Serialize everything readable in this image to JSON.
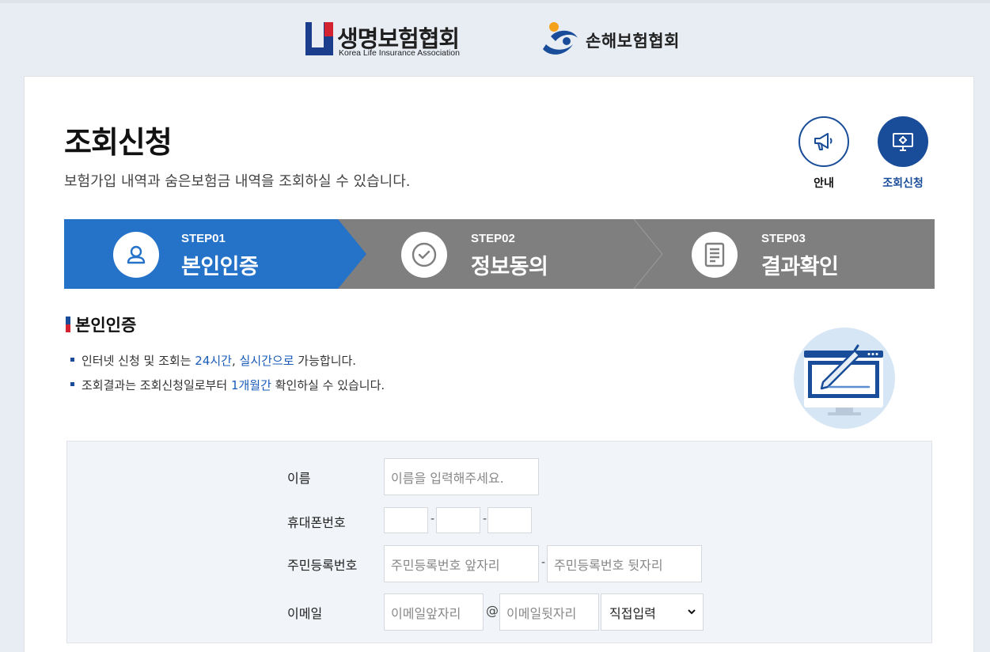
{
  "header": {
    "life_logo_name": "생명보험협회",
    "life_logo_sub": "Korea Life Insurance Association",
    "nonlife_logo_name": "손해보험협회"
  },
  "page": {
    "title": "조회신청",
    "description": "보험가입 내역과 숨은보험금 내역을 조회하실 수 있습니다."
  },
  "quick_links": {
    "guide_label": "안내",
    "inquiry_label": "조회신청"
  },
  "steps": [
    {
      "num": "STEP01",
      "name": "본인인증",
      "active": true
    },
    {
      "num": "STEP02",
      "name": "정보동의",
      "active": false
    },
    {
      "num": "STEP03",
      "name": "결과확인",
      "active": false
    }
  ],
  "colors": {
    "active_step": "#2572c9",
    "inactive_step": "#7f7f7f",
    "brand_blue": "#1a4d99",
    "brand_red": "#d32230"
  },
  "section": {
    "title": "본인인증",
    "note1_pre": "인터넷 신청 및 조회는 ",
    "note1_hl1": "24시간",
    "note1_mid": ", ",
    "note1_hl2": "실시간으로",
    "note1_post": " 가능합니다.",
    "note2_pre": "조회결과는 조회신청일로부터 ",
    "note2_hl": "1개월간",
    "note2_post": " 확인하실 수 있습니다."
  },
  "form": {
    "name_label": "이름",
    "name_placeholder": "이름을 입력해주세요.",
    "phone_label": "휴대폰번호",
    "phone_sep": "-",
    "rrn_label": "주민등록번호",
    "rrn_front_placeholder": "주민등록번호 앞자리",
    "rrn_sep": "-",
    "rrn_back_placeholder": "주민등록번호 뒷자리",
    "email_label": "이메일",
    "email_front_placeholder": "이메일앞자리",
    "email_at": "@",
    "email_back_placeholder": "이메일뒷자리",
    "email_domain_selected": "직접입력"
  }
}
